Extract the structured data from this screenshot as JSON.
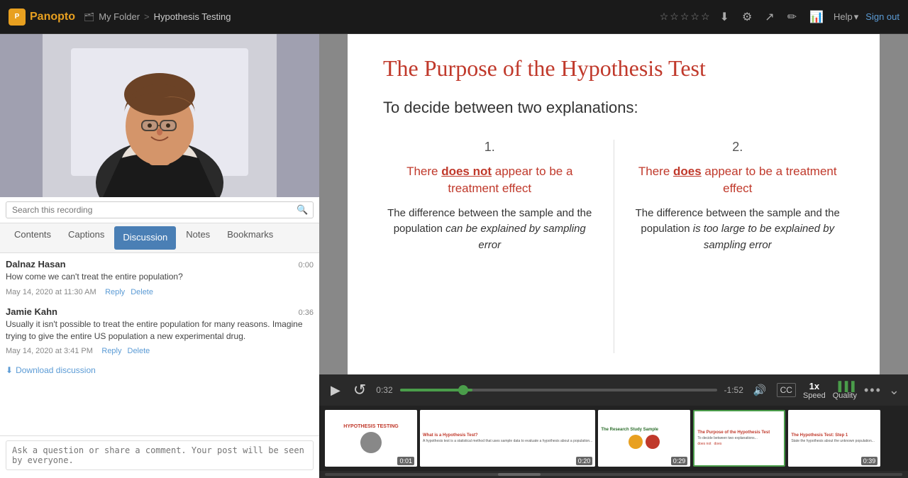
{
  "app": {
    "name": "Panopto",
    "breadcrumb_folder": "My Folder",
    "breadcrumb_separator": ">",
    "breadcrumb_current": "Hypothesis Testing"
  },
  "topbar": {
    "help_label": "Help",
    "signout_label": "Sign out",
    "stars": [
      "☆",
      "☆",
      "☆",
      "☆",
      "☆"
    ]
  },
  "sidebar": {
    "search_placeholder": "Search this recording",
    "nav_items": [
      {
        "label": "Contents",
        "active": false
      },
      {
        "label": "Captions",
        "active": false
      },
      {
        "label": "Discussion",
        "active": true
      },
      {
        "label": "Notes",
        "active": false
      },
      {
        "label": "Bookmarks",
        "active": false
      }
    ],
    "comments": [
      {
        "author": "Dalnaz Hasan",
        "time": "0:00",
        "text": "How come we can't treat the entire population?",
        "date": "May 14, 2020 at 11:30 AM",
        "reply_label": "Reply",
        "delete_label": "Delete"
      },
      {
        "author": "Jamie Kahn",
        "time": "0:36",
        "text": "Usually it isn't possible to treat the entire population for many reasons. Imagine trying to give the entire US population a new experimental drug.",
        "date": "May 14, 2020 at 3:41 PM",
        "reply_label": "Reply",
        "delete_label": "Delete"
      }
    ],
    "download_label": "Download discussion",
    "comment_placeholder": "Ask a question or share a comment. Your post will be seen by everyone."
  },
  "slide": {
    "title": "The Purpose of the Hypothesis Test",
    "subtitle": "To decide between two explanations:",
    "col1_number": "1.",
    "col1_heading_pre": "There ",
    "col1_heading_underline": "does not",
    "col1_heading_post": " appear to be a treatment effect",
    "col1_desc": "The difference between the sample and the population can be explained by sampling error",
    "col2_number": "2.",
    "col2_heading_pre": "There ",
    "col2_heading_underline": "does",
    "col2_heading_post": " appear to be a treatment effect",
    "col2_desc": "The difference between the sample and the population is too large to be explained by sampling error"
  },
  "controls": {
    "play_icon": "▶",
    "rewind_icon": "⟲",
    "current_time": "0:32",
    "remaining_time": "-1:52",
    "progress_percent": 23,
    "volume_icon": "🔊",
    "captions_icon": "CC",
    "speed_label": "Speed",
    "speed_value": "1x",
    "quality_label": "Quality",
    "more_icon": "•••",
    "expand_icon": "⌄"
  },
  "thumbnails": [
    {
      "time": "0:01",
      "title": "HYPOTHESIS TESTING",
      "active": false
    },
    {
      "time": "0:20",
      "title": "What is a Hypothesis Test?",
      "active": false
    },
    {
      "time": "0:29",
      "title": "The Research Study Sample",
      "active": false
    },
    {
      "time": "",
      "title": "The Purpose of the Hypothesis Test",
      "active": true
    },
    {
      "time": "0:39",
      "title": "The Hypothesis Test: Step 1",
      "active": false
    }
  ]
}
